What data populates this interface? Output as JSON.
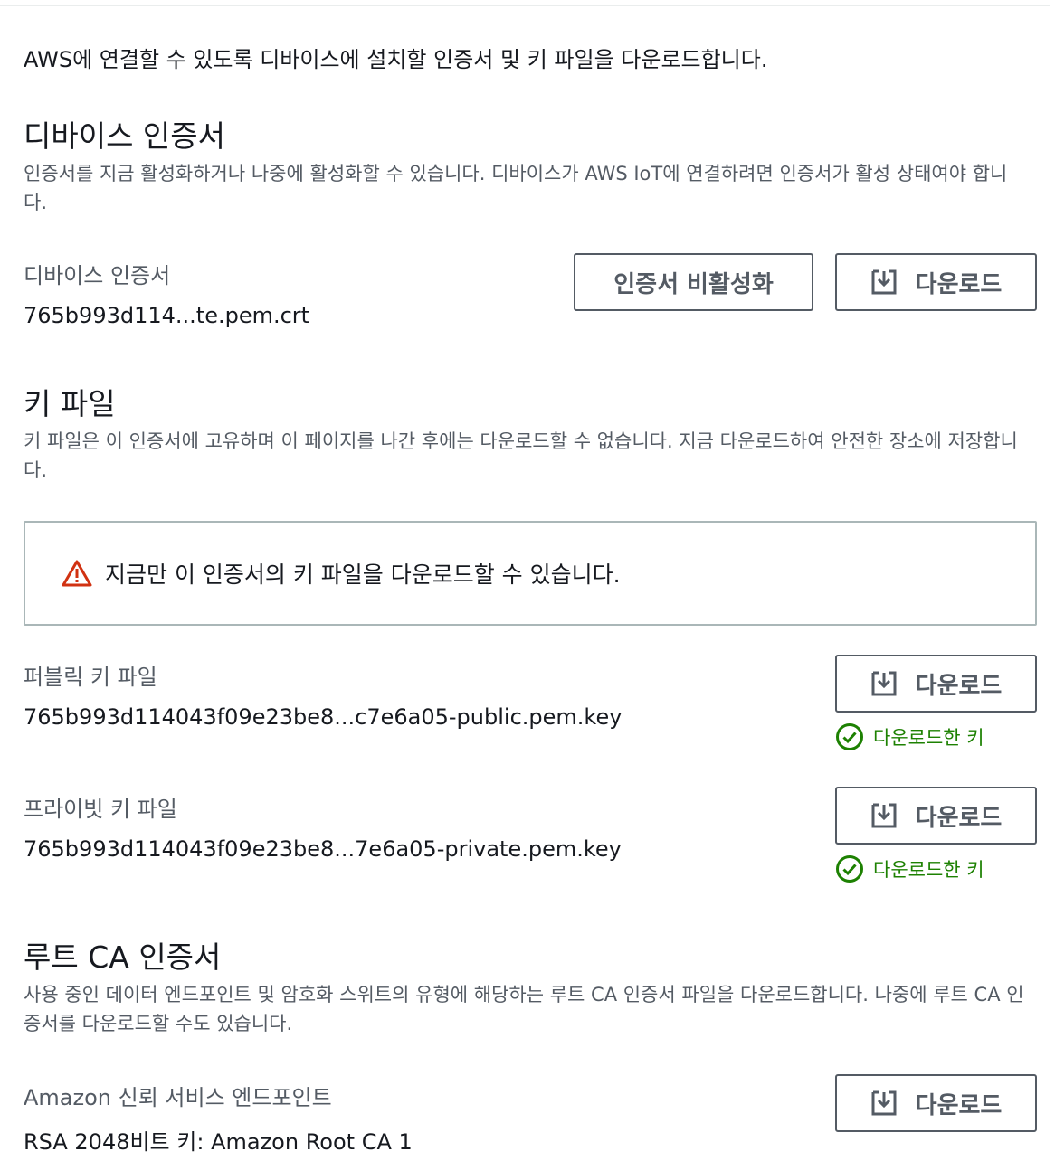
{
  "intro": "AWS에 연결할 수 있도록 디바이스에 설치할 인증서 및 키 파일을 다운로드합니다.",
  "device_cert": {
    "heading": "디바이스 인증서",
    "description": "인증서를 지금 활성화하거나 나중에 활성화할 수 있습니다. 디바이스가 AWS IoT에 연결하려면 인증서가 활성 상태여야 합니다.",
    "label": "디바이스 인증서",
    "filename": "765b993d114...te.pem.crt",
    "deactivate_label": "인증서 비활성화",
    "download_label": "다운로드"
  },
  "key_files": {
    "heading": "키 파일",
    "description": "키 파일은 이 인증서에 고유하며 이 페이지를 나간 후에는 다운로드할 수 없습니다. 지금 다운로드하여 안전한 장소에 저장합니다.",
    "alert": "지금만 이 인증서의 키 파일을 다운로드할 수 있습니다.",
    "public": {
      "label": "퍼블릭 키 파일",
      "filename": "765b993d114043f09e23be8...c7e6a05-public.pem.key",
      "download_label": "다운로드",
      "status": "다운로드한 키"
    },
    "private": {
      "label": "프라이빗 키 파일",
      "filename": "765b993d114043f09e23be8...7e6a05-private.pem.key",
      "download_label": "다운로드",
      "status": "다운로드한 키"
    }
  },
  "root_ca": {
    "heading": "루트 CA 인증서",
    "description": "사용 중인 데이터 엔드포인트 및 암호화 스위트의 유형에 해당하는 루트 CA 인증서 파일을 다운로드합니다. 나중에 루트 CA 인증서를 다운로드할 수도 있습니다.",
    "label": "Amazon 신뢰 서비스 엔드포인트",
    "value": "RSA 2048비트 키: Amazon Root CA 1",
    "download_label": "다운로드"
  },
  "colors": {
    "success": "#1d8102",
    "warning": "#d13212",
    "button_border": "#545b64"
  }
}
